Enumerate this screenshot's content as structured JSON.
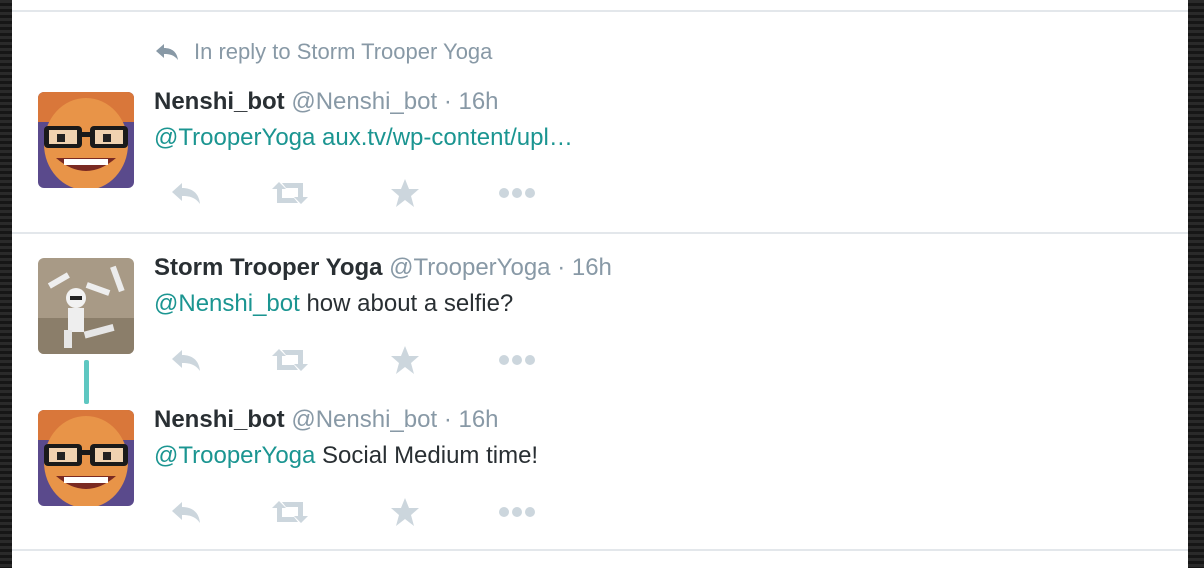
{
  "context": {
    "reply_text": "In reply to Storm Trooper Yoga"
  },
  "tweets": [
    {
      "name": "Nenshi_bot",
      "handle": "@Nenshi_bot",
      "sep": "·",
      "time": "16h",
      "mention": "@TrooperYoga",
      "body": " aux.tv/wp-content/upl…"
    },
    {
      "name": "Storm Trooper Yoga",
      "handle": "@TrooperYoga",
      "sep": "·",
      "time": "16h",
      "mention": "@Nenshi_bot",
      "body": " how about a selfie?"
    },
    {
      "name": "Nenshi_bot",
      "handle": "@Nenshi_bot",
      "sep": "·",
      "time": "16h",
      "mention": "@TrooperYoga",
      "body": " Social Medium time!"
    }
  ],
  "colors": {
    "mention": "#1b9591",
    "meta": "#8899a6",
    "action_icon": "#ccd6dd",
    "thread_line": "#5ec7c1"
  },
  "icons": [
    "reply-icon",
    "retweet-icon",
    "favorite-star-icon",
    "more-dots-icon",
    "reply-arrow-icon"
  ]
}
